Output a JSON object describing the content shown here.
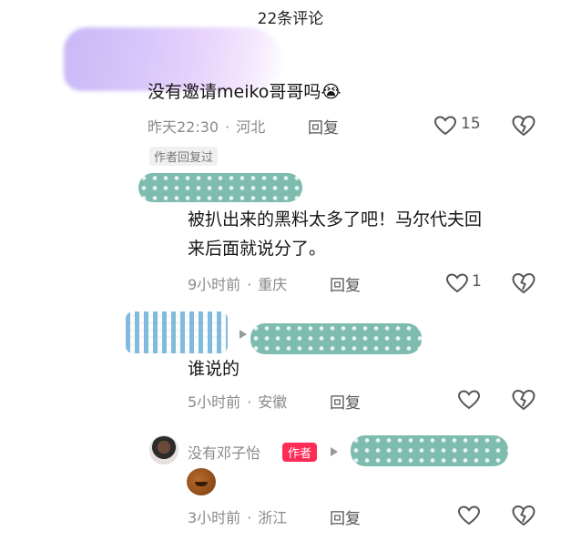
{
  "header": {
    "title": "22条评论"
  },
  "comments": [
    {
      "text": "没有邀请meiko哥哥吗😭",
      "time": "昨天22:30",
      "location": "河北",
      "reply_label": "回复",
      "likes": "15",
      "badge": "作者回复过"
    },
    {
      "text_line1": "被扒出来的黑料太多了吧！马尔代夫回",
      "text_line2": "来后面就说分了。",
      "time": "9小时前",
      "location": "重庆",
      "reply_label": "回复",
      "likes": "1"
    },
    {
      "text": "谁说的",
      "time": "5小时前",
      "location": "安徽",
      "reply_label": "回复"
    },
    {
      "username": "没有邓子怡",
      "author_tag": "作者",
      "time": "3小时前",
      "location": "浙江",
      "reply_label": "回复"
    }
  ],
  "icons": {
    "like": "heart-outline-icon",
    "dislike": "broken-heart-icon",
    "reply_arrow": "triangle-right-icon",
    "emoji": "cookie-emoji-icon"
  },
  "colors": {
    "author_tag": "#fe2c55",
    "meta_text": "#8a8a8a",
    "mosaic": "#7fbcb0"
  }
}
